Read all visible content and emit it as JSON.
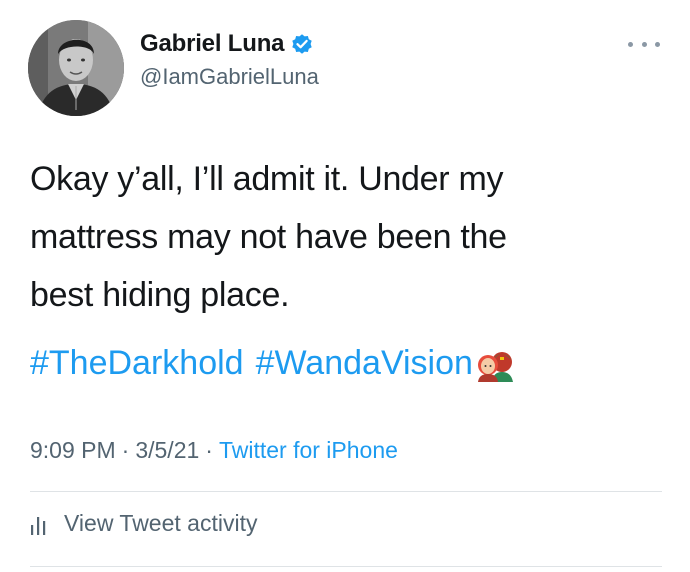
{
  "author": {
    "display_name": "Gabriel Luna",
    "handle": "@IamGabrielLuna",
    "verified": true
  },
  "tweet": {
    "lines": [
      "Okay y’all, I’ll admit it. Under my",
      "mattress may not have been the",
      "best hiding place."
    ],
    "hashtags": [
      "#TheDarkhold",
      "#WandaVision"
    ],
    "emoji": "wanda-vision-couple-emoji"
  },
  "meta": {
    "time": "9:09 PM",
    "separator": "·",
    "date": "3/5/21",
    "source": "Twitter for iPhone"
  },
  "actions": {
    "view_activity": "View Tweet activity"
  },
  "colors": {
    "link": "#1d9bf0",
    "secondary": "#536471",
    "verified": "#1d9bf0",
    "divider": "#dfe3e6"
  }
}
